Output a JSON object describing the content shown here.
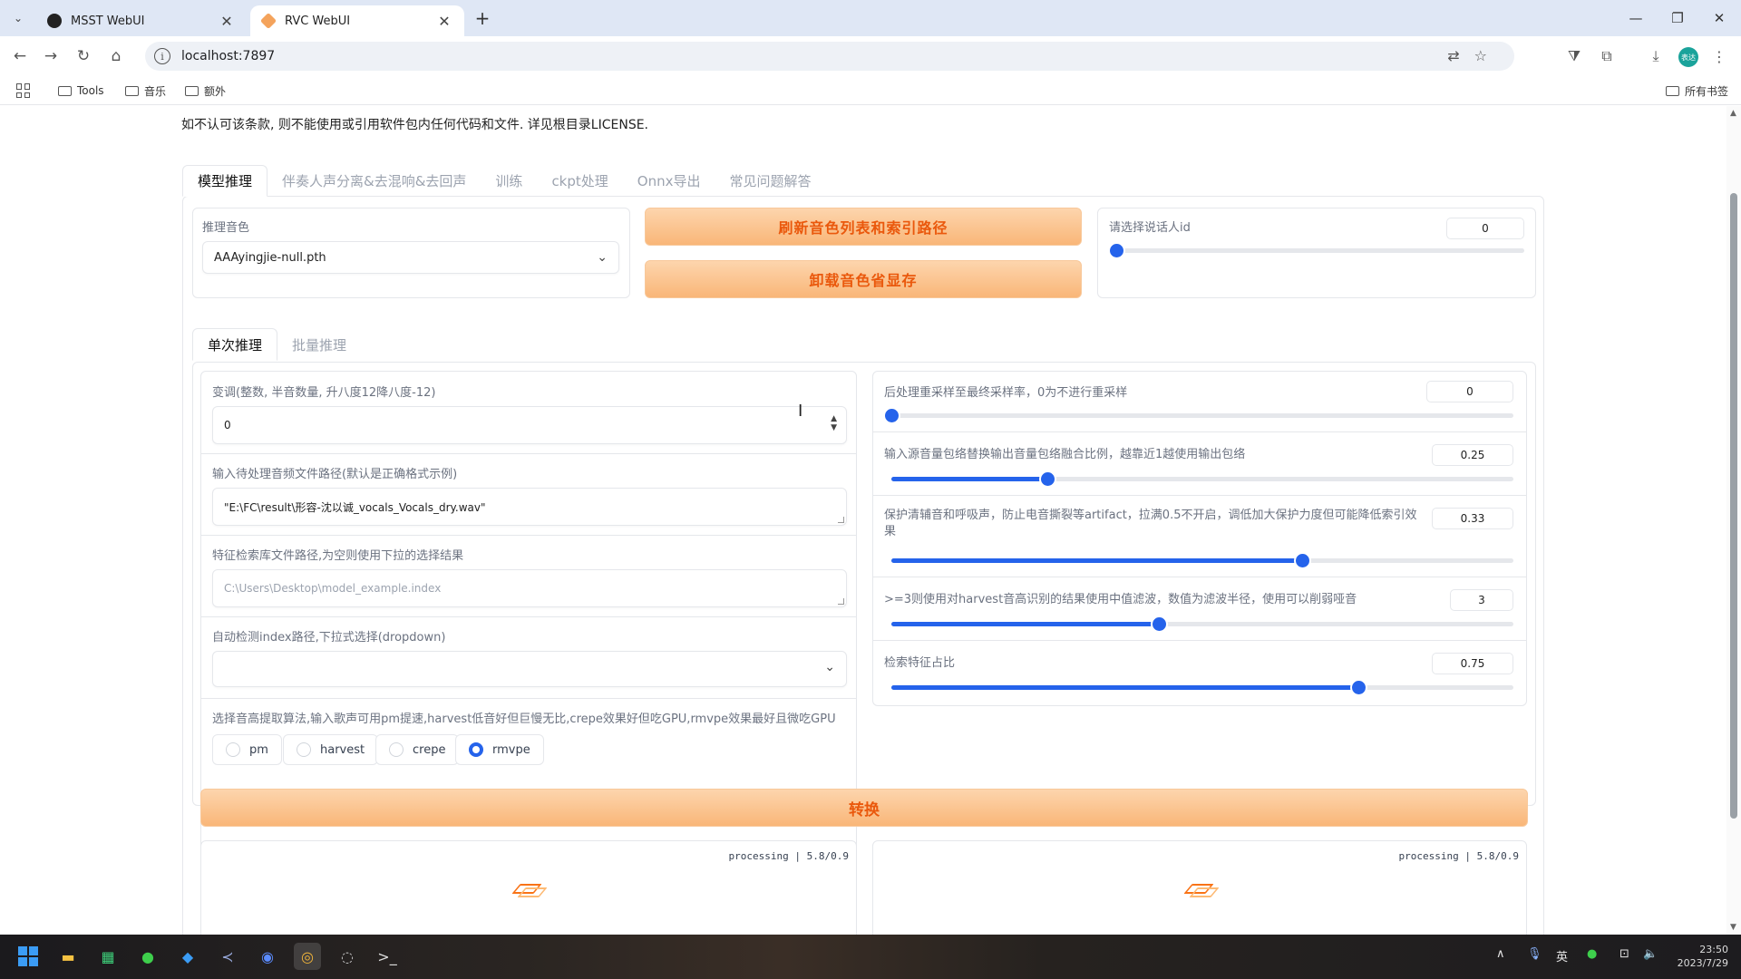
{
  "browser": {
    "tabs": [
      {
        "title": "MSST WebUI",
        "active": false
      },
      {
        "title": "RVC WebUI",
        "active": true
      }
    ],
    "url": "localhost:7897",
    "bookmarks": [
      "Tools",
      "音乐",
      "额外"
    ],
    "all_bookmarks": "所有书签",
    "profile_initials": "表达"
  },
  "license_text": "如不认可该条款, 则不能使用或引用软件包内任何代码和文件. 详见根目录LICENSE.",
  "main_tabs": [
    "模型推理",
    "伴奏人声分离&去混响&去回声",
    "训练",
    "ckpt处理",
    "Onnx导出",
    "常见问题解答"
  ],
  "model": {
    "voice_label": "推理音色",
    "voice_value": "AAAyingjie-null.pth",
    "refresh_button": "刷新音色列表和索引路径",
    "unload_button": "卸载音色省显存",
    "speaker_label": "请选择说话人id",
    "speaker_value": "0",
    "speaker_fraction": 0
  },
  "sub_tabs": [
    "单次推理",
    "批量推理"
  ],
  "left_panel": {
    "pitch_label": "变调(整数, 半音数量, 升八度12降八度-12)",
    "pitch_value": "0",
    "input_label": "输入待处理音频文件路径(默认是正确格式示例)",
    "input_value": "\"E:\\FC\\result\\形容-沈以诚_vocals_Vocals_dry.wav\"",
    "index_label": "特征检索库文件路径,为空则使用下拉的选择结果",
    "index_placeholder": "C:\\Users\\Desktop\\model_example.index",
    "auto_index_label": "自动检测index路径,下拉式选择(dropdown)",
    "auto_index_value": "",
    "f0_label": "选择音高提取算法,输入歌声可用pm提速,harvest低音好但巨慢无比,crepe效果好但吃GPU,rmvpe效果最好且微吃GPU",
    "f0_options": [
      "pm",
      "harvest",
      "crepe",
      "rmvpe"
    ],
    "f0_selected": "rmvpe"
  },
  "right_panel": {
    "sliders": [
      {
        "label": "后处理重采样至最终采样率，0为不进行重采样",
        "value": "0",
        "fraction": 0.0
      },
      {
        "label": "输入源音量包络替换输出音量包络融合比例，越靠近1越使用输出包络",
        "value": "0.25",
        "fraction": 0.25
      },
      {
        "label": "保护清辅音和呼吸声，防止电音撕裂等artifact，拉满0.5不开启，调低加大保护力度但可能降低索引效果",
        "value": "0.33",
        "fraction": 0.66
      },
      {
        "label": ">=3则使用对harvest音高识别的结果使用中值滤波，数值为滤波半径，使用可以削弱哑音",
        "value": "3",
        "fraction": 0.43
      },
      {
        "label": "检索特征占比",
        "value": "0.75",
        "fraction": 0.75
      }
    ]
  },
  "convert_button": "转换",
  "outputs": [
    {
      "status": "processing | 5.8/0.9"
    },
    {
      "status": "processing | 5.8/0.9"
    }
  ],
  "taskbar": {
    "tray_lang": "英",
    "time": "23:50",
    "date": "2023/7/29"
  }
}
